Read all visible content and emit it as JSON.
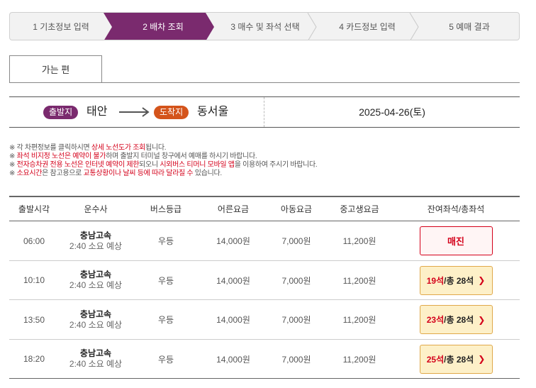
{
  "steps": [
    {
      "label": "1 기초정보 입력",
      "active": false
    },
    {
      "label": "2 배차 조회",
      "active": true
    },
    {
      "label": "3 매수 및 좌석 선택",
      "active": false
    },
    {
      "label": "4 카드정보 입력",
      "active": false
    },
    {
      "label": "5 예매 결과",
      "active": false
    }
  ],
  "tab": {
    "label": "가는 편"
  },
  "route": {
    "dep_badge": "출발지",
    "dep_city": "태안",
    "arr_badge": "도착지",
    "arr_city": "동서울",
    "date": "2025-04-26(토)"
  },
  "notices": {
    "n1": {
      "a": "※ 각 차편정보를 클릭하시면 ",
      "b": "상세 노선도가 조회",
      "c": "됩니다."
    },
    "n2": {
      "a": "※ ",
      "b": "좌석 비지정 노선은 예약이 불가",
      "c": "하며 출발지 터미널 창구에서 예매를 하시기 바랍니다."
    },
    "n3": {
      "a": "※ ",
      "b": "전자승차권 전용 노선은 인터넷 예약이 제한",
      "c": "되오니 ",
      "d": "시외버스 티머니 모바일 앱",
      "e": "을 이용하여 주시기 바랍니다."
    },
    "n4": {
      "a": "※ ",
      "b": "소요시간",
      "c": "은 참고용으로 ",
      "d": "교통상황이나 날씨 등에 따라 달라질 수",
      "e": " 있습니다."
    }
  },
  "table": {
    "headers": [
      "출발시각",
      "운수사",
      "버스등급",
      "어른요금",
      "아동요금",
      "중고생요금",
      "잔여좌석/총좌석"
    ],
    "rows": [
      {
        "time": "06:00",
        "company": "충남고속",
        "duration": "2:40 소요 예상",
        "grade": "우등",
        "adult": "14,000원",
        "child": "7,000원",
        "youth": "11,200원",
        "sold_out": true,
        "seat_label": "매진"
      },
      {
        "time": "10:10",
        "company": "충남고속",
        "duration": "2:40 소요 예상",
        "grade": "우등",
        "adult": "14,000원",
        "child": "7,000원",
        "youth": "11,200원",
        "sold_out": false,
        "remain": "19석",
        "total": " /총 28석"
      },
      {
        "time": "13:50",
        "company": "충남고속",
        "duration": "2:40 소요 예상",
        "grade": "우등",
        "adult": "14,000원",
        "child": "7,000원",
        "youth": "11,200원",
        "sold_out": false,
        "remain": "23석",
        "total": " /총 28석"
      },
      {
        "time": "18:20",
        "company": "충남고속",
        "duration": "2:40 소요 예상",
        "grade": "우등",
        "adult": "14,000원",
        "child": "7,000원",
        "youth": "11,200원",
        "sold_out": false,
        "remain": "25석",
        "total": " /총 28석"
      }
    ]
  },
  "colors": {
    "step_active": "#7a2a6e",
    "dep_badge": "#7a2a6e",
    "arr_badge": "#d4541b",
    "accent_red": "#d4001a",
    "seat_available_bg": "#fdf0c8"
  },
  "icons": {
    "route_arrow": "long-right-arrow-icon",
    "seat_chevron": "chevron-right-icon"
  }
}
